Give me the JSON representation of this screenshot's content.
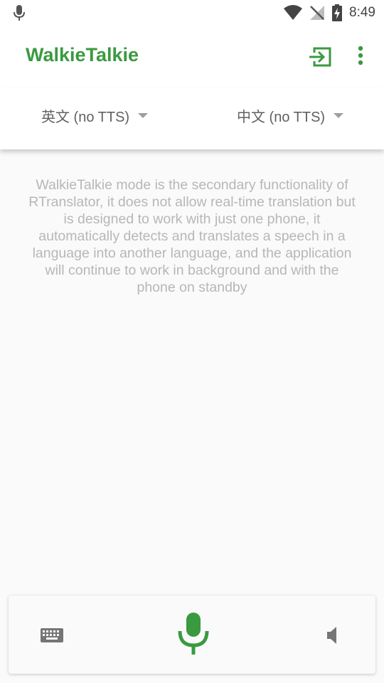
{
  "status_bar": {
    "time": "8:49",
    "icons": [
      "mic-icon",
      "wifi-icon",
      "no-signal-icon",
      "battery-charging-icon"
    ]
  },
  "app_bar": {
    "title": "WalkieTalkie",
    "exit_icon": "exit-icon",
    "menu_icon": "more-vert-icon"
  },
  "languages": {
    "first": "英文 (no TTS)",
    "second": "中文 (no TTS)"
  },
  "description": "WalkieTalkie mode is the secondary functionality of RTranslator, it does not allow real-time translation but is designed to work with just one phone, it automatically detects and translates a speech in a language into another language, and the application will continue to work in background and with the phone on standby",
  "bottom_panel": {
    "keyboard_icon": "keyboard-icon",
    "mic_icon": "mic-icon",
    "sound_icon": "sound-icon"
  },
  "colors": {
    "accent": "#3a9a3f",
    "text_secondary": "#616161",
    "description_text": "#b7b7b7"
  }
}
